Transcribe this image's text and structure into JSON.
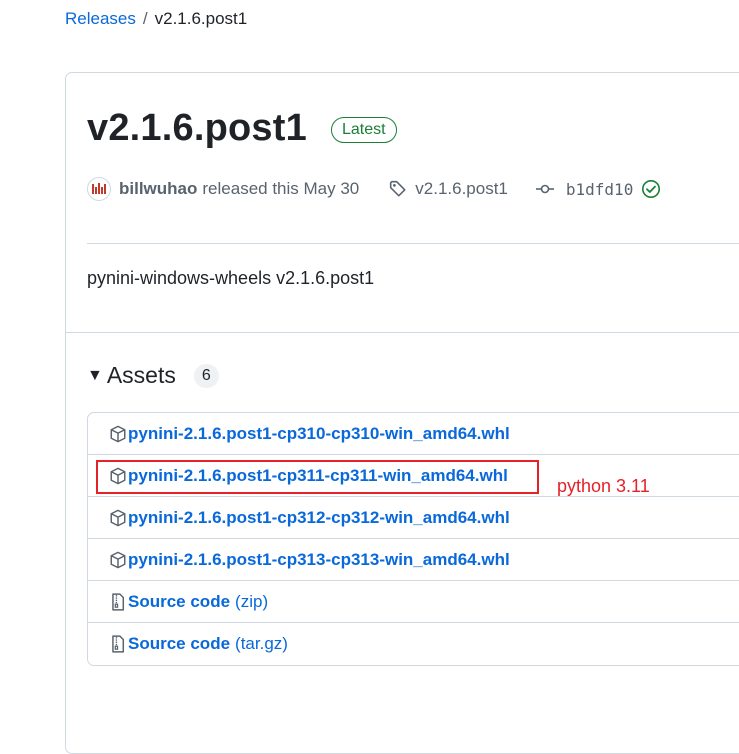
{
  "breadcrumb": {
    "releases_label": "Releases",
    "separator": "/",
    "current": "v2.1.6.post1"
  },
  "release": {
    "title": "v2.1.6.post1",
    "badge": "Latest",
    "author": "billwuhao",
    "released_text": "released this May 30",
    "tag": "v2.1.6.post1",
    "commit": "b1dfd10",
    "description": "pynini-windows-wheels v2.1.6.post1"
  },
  "assets": {
    "title": "Assets",
    "count": "6",
    "items": [
      {
        "name": "pynini-2.1.6.post1-cp310-cp310-win_amd64.whl",
        "suffix": "",
        "icon": "package-icon"
      },
      {
        "name": "pynini-2.1.6.post1-cp311-cp311-win_amd64.whl",
        "suffix": "",
        "icon": "package-icon"
      },
      {
        "name": "pynini-2.1.6.post1-cp312-cp312-win_amd64.whl",
        "suffix": "",
        "icon": "package-icon"
      },
      {
        "name": "pynini-2.1.6.post1-cp313-cp313-win_amd64.whl",
        "suffix": "",
        "icon": "package-icon"
      },
      {
        "name": "Source code",
        "suffix": "(zip)",
        "icon": "file-zip-icon"
      },
      {
        "name": "Source code",
        "suffix": "(tar.gz)",
        "icon": "file-zip-icon"
      }
    ]
  },
  "annotation": {
    "text": "python 3.11",
    "color": "#e5212a"
  },
  "colors": {
    "link": "#0969da",
    "success": "#1a7f37",
    "muted": "#59636e",
    "border": "#d1d9e0"
  }
}
